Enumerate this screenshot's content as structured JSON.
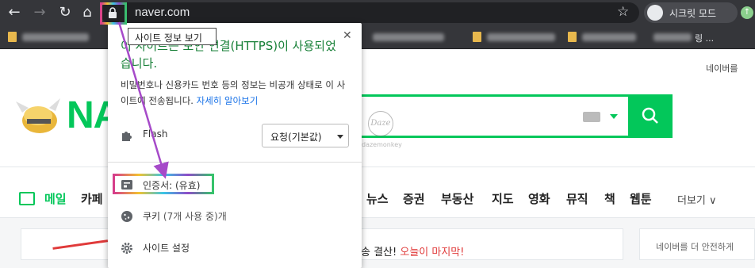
{
  "browser": {
    "url": "naver.com",
    "profile_label": "시크릿 모드",
    "bookmarks": [
      {
        "label": ""
      },
      {
        "label": ""
      },
      {
        "label": ""
      },
      {
        "label": ""
      },
      {
        "label": ""
      },
      {
        "label": "링 ..."
      }
    ]
  },
  "tooltip": {
    "text": "사이트 정보 보기"
  },
  "popup": {
    "headline": "이 사이트는 보안 연결(HTTPS)이 사용되었습니다.",
    "body": "비밀번호나 신용카드 번호 등의 정보는 비공개 상태로 이 사이트에 전송됩니다. ",
    "learn_more": "자세히 알아보기",
    "flash_label": "Flash",
    "flash_value": "요청(기본값)",
    "certificate_label": "인증서: (유효)",
    "cookies_label": "쿠키",
    "cookies_detail": " (7개 사용 중)개",
    "site_settings_label": "사이트 설정"
  },
  "naver": {
    "logo": "NA",
    "login_text": "네이버를",
    "watermark_name": "Daze",
    "watermark_caption": "dazemonkey",
    "nav": [
      "메일",
      "카페",
      "뉴스",
      "증권",
      "부동산",
      "지도",
      "영화",
      "뮤직",
      "책",
      "웹툰"
    ],
    "more_label": "더보기 ∨",
    "banner_text": "송 결산! ",
    "banner_highlight": "오늘이 마지막!",
    "side_text": "네이버를 더 안전하게"
  },
  "colors": {
    "naver_green": "#03c75a",
    "secure_green": "#188038",
    "link_blue": "#1a73e8",
    "arrow_purple": "#a64ac9",
    "chrome_dark": "#35363a"
  }
}
